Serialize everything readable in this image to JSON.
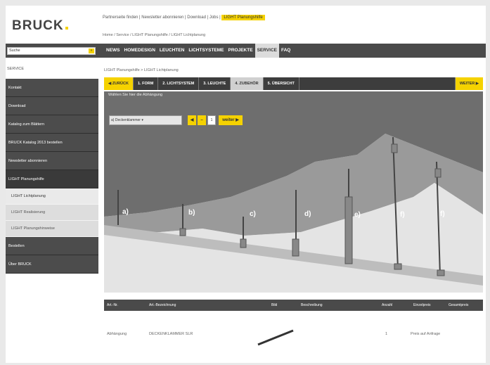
{
  "header": {
    "logo": "BRUCK",
    "top_links": [
      "Partnerseite finden",
      "Newsletter abonnieren",
      "Download",
      "Jobs"
    ],
    "highlight_link": "LIGHT Planungshilfe",
    "breadcrumb": "Home / Service / LIGHT Planungshilfe / LIGHT Lichtplanung"
  },
  "search": {
    "value": "Suche",
    "button": "»"
  },
  "nav": [
    "NEWS",
    "HOMEDESIGN",
    "LEUCHTEN",
    "LICHTSYSTEME",
    "PROJEKTE",
    "SERVICE",
    "FAQ"
  ],
  "nav_active_index": 5,
  "sidebar": {
    "title": "SERVICE",
    "items": [
      "Kontakt",
      "Download",
      "Katalog zum Blättern",
      "BRUCK Katalog 2013 bestellen",
      "Newsletter abonnieren",
      "LIGHT Planungshilfe"
    ],
    "subitems": [
      "LIGHT Lichtplanung",
      "LIGHT Realisierung",
      "LIGHT Planungshinweise"
    ],
    "items_after": [
      "Bestellen",
      "Über BRUCK"
    ]
  },
  "main": {
    "breadcrumb": "LIGHT Planungshilfe > LIGHT Lichtplanung",
    "steps": {
      "back": "◀ ZURÜCK",
      "items": [
        "1. FORM",
        "2. LICHTSYSTEM",
        "3. LEUCHTE",
        "4. ZUBEHÖR",
        "5. ÜBERSICHT"
      ],
      "active_index": 3,
      "next": "WEITER ▶"
    }
  },
  "viewer": {
    "title": "Wählen Sie hier die Abhängung",
    "select_value": "a) Deckenklammer",
    "count_value": "1",
    "add_label": "weiter",
    "labels": [
      "a)",
      "b)",
      "c)",
      "d)",
      "e)",
      "f)",
      "f)"
    ]
  },
  "table": {
    "headers": [
      "Art.-Nr.",
      "Art.-Bezeichnung",
      "Bild",
      "Beschreibung",
      "Anzahl",
      "Einzelpreis",
      "Gesamtpreis"
    ],
    "row": {
      "art_nr": "Abhängung",
      "bezeichnung": "DECKENKLAMMER SLR",
      "anzahl": "1",
      "preis": "Preis auf Anfrage"
    }
  },
  "colors": {
    "accent": "#f5d200",
    "nav": "#4a4a4a"
  }
}
